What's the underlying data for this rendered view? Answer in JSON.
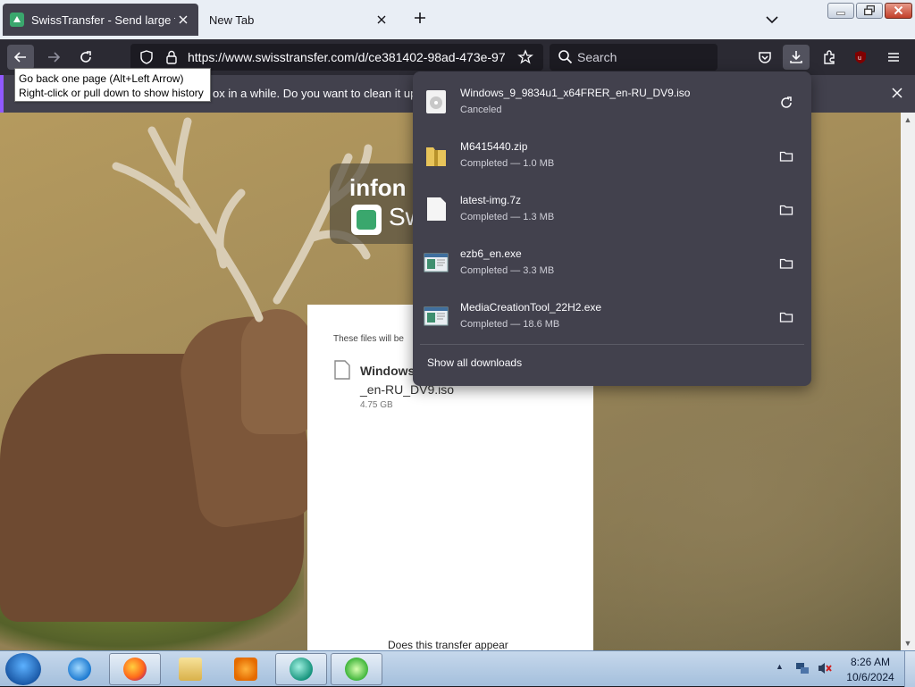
{
  "tabs": [
    {
      "title": "SwissTransfer - Send large files",
      "active": true
    },
    {
      "title": "New Tab",
      "active": false
    }
  ],
  "toolbar": {
    "url": "https://www.swisstransfer.com/d/ce381402-98ad-473e-97",
    "search_placeholder": "Search",
    "ublock_badge": "1",
    "icons": [
      "back-arrow-icon",
      "forward-arrow-icon",
      "reload-icon",
      "shield-icon",
      "lock-icon",
      "star-icon",
      "search-icon",
      "pocket-icon",
      "download-icon",
      "extensions-icon",
      "ublock-icon",
      "hamburger-menu-icon"
    ]
  },
  "tooltip": {
    "line1": "Go back one page (Alt+Left Arrow)",
    "line2": "Right-click or pull down to show history"
  },
  "notification": {
    "text": "ox in a while. Do you want to clean it up for"
  },
  "page": {
    "brand_text": "infon",
    "brand_sw": "Sw",
    "expiry_text": "These files will be",
    "file_name": "Windows",
    "file_name_2": "_en-RU_DV9.iso",
    "file_size": "4.75 GB",
    "appear_text": "Does this transfer appear"
  },
  "downloads": {
    "items": [
      {
        "name": "Windows_9_9834u1_x64FRER_en-RU_DV9.iso",
        "status": "Canceled",
        "action": "retry-icon",
        "file_icon": "disc-image-icon"
      },
      {
        "name": "M6415440.zip",
        "status": "Completed — 1.0 MB",
        "action": "folder-icon",
        "file_icon": "zip-folder-icon"
      },
      {
        "name": "latest-img.7z",
        "status": "Completed — 1.3 MB",
        "action": "folder-icon",
        "file_icon": "blank-file-icon"
      },
      {
        "name": "ezb6_en.exe",
        "status": "Completed — 3.3 MB",
        "action": "folder-icon",
        "file_icon": "exe-window-icon"
      },
      {
        "name": "MediaCreationTool_22H2.exe",
        "status": "Completed — 18.6 MB",
        "action": "folder-icon",
        "file_icon": "exe-window-icon"
      }
    ],
    "show_all_label": "Show all downloads"
  },
  "taskbar": {
    "apps": [
      "internet-explorer-icon",
      "firefox-icon",
      "file-explorer-icon",
      "media-player-icon",
      "app-teal-icon",
      "app-green-icon"
    ],
    "time": "8:26 AM",
    "date": "10/6/2024"
  }
}
